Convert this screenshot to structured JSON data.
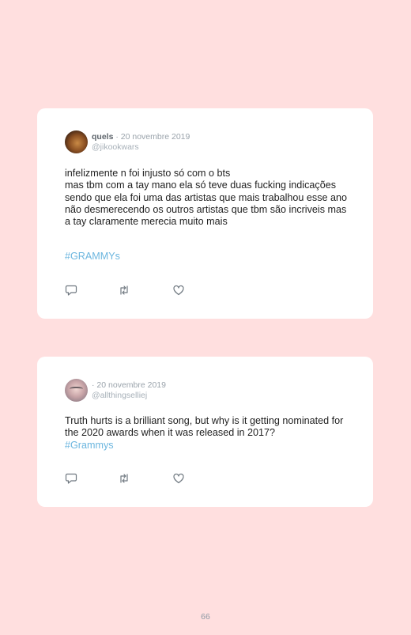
{
  "tweets": [
    {
      "display_name": "quels",
      "date": "· 20 novembre 2019",
      "handle": "@jikookwars",
      "text": "infelizmente n foi injusto só com o bts\nmas tbm com a tay mano ela só teve duas fucking indicações sendo que ela foi uma das artistas que mais trabalhou esse ano não desmerecendo os outros artistas que tbm são incriveis mas a tay claramente merecia muito mais",
      "hashtag": "#GRAMMYs"
    },
    {
      "display_name": "",
      "date": "· 20 novembre 2019",
      "handle": "@allthingselliej",
      "text": "Truth hurts is a brilliant song, but why is it getting nominated for the 2020 awards when it was released in 2017?",
      "hashtag": "#Grammys"
    }
  ],
  "icons": [
    "reply-icon",
    "retweet-icon",
    "like-icon"
  ],
  "page_number": "66",
  "colors": {
    "background": "#ffdfdf",
    "card": "#ffffff",
    "hashtag": "#6cb6df",
    "muted": "#9aa3ab"
  }
}
